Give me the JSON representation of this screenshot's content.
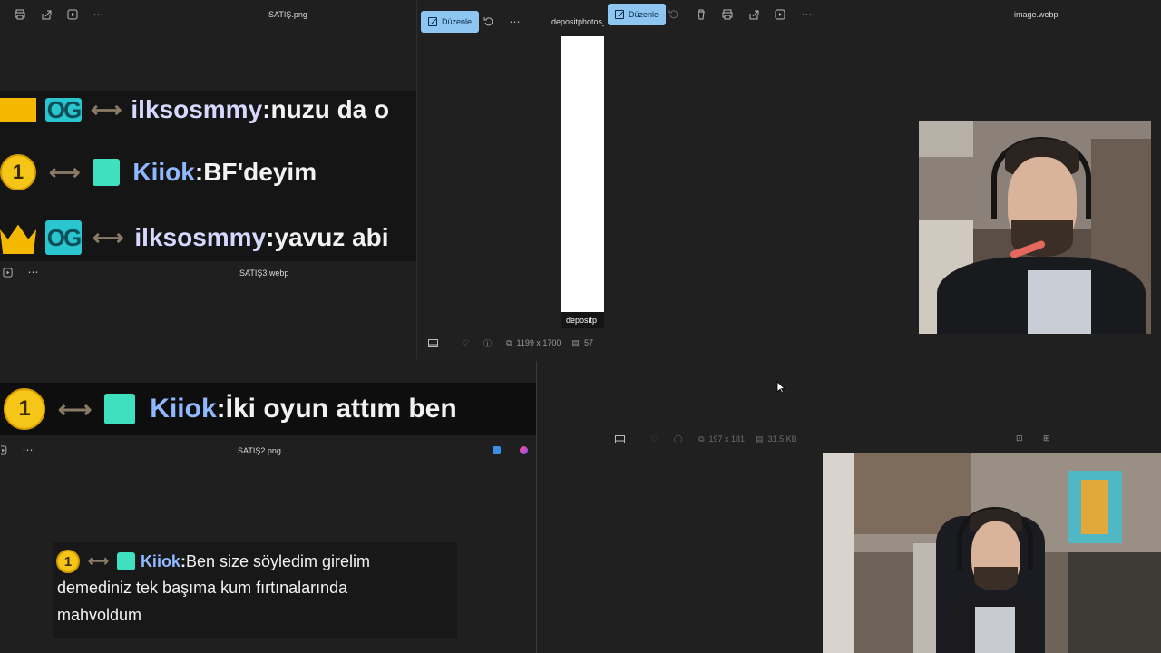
{
  "windows": {
    "satis": {
      "title": "SATIŞ.png"
    },
    "satis3": {
      "title": "SATIŞ3.webp"
    },
    "satis2": {
      "title": "SATIŞ2.png"
    },
    "deposit": {
      "title": "depositphotos_2",
      "edit_label": "Düzenle",
      "dimensions": "1199 x 1700",
      "size_partial": "57",
      "watermark": "depositp"
    },
    "image": {
      "title": "image.webp",
      "edit_label": "Düzenle",
      "dimensions": "197 x 181",
      "size": "31.5 KB"
    }
  },
  "chat": {
    "top_partial": {
      "user": "ilksosmmy",
      "text": "nuzu da o"
    },
    "line1": {
      "badge": "1",
      "user": "Kiiok",
      "sep": ":",
      "text": " BF'deyim"
    },
    "line2": {
      "user": "ilksosmmy",
      "sep": ":",
      "text": " yavuz abi"
    },
    "line3": {
      "badge": "1",
      "user": "Kiiok",
      "sep": ":",
      "text": " İki oyun attım ben"
    },
    "line4": {
      "badge": "1",
      "user": "Kiiok",
      "sep": ":",
      "text1": " Ben size söyledim girelim",
      "text2": "demediniz tek başıma kum fırtınalarında",
      "text3": "mahvoldum"
    },
    "badge_text": {
      "og": "OG"
    }
  },
  "icons": [
    "print-icon",
    "share-icon",
    "slideshow-icon",
    "more-icon",
    "rotate-icon",
    "delete-icon",
    "filmstrip-icon",
    "heart-icon",
    "info-icon",
    "dimensions-icon",
    "filesize-icon",
    "fit-icon",
    "crop-icon",
    "cursor-icon"
  ],
  "colors": {
    "accent": "#8ec6f2",
    "gold": "#f5c518",
    "teal": "#3fe0c0",
    "username": "#8fb8ff"
  }
}
